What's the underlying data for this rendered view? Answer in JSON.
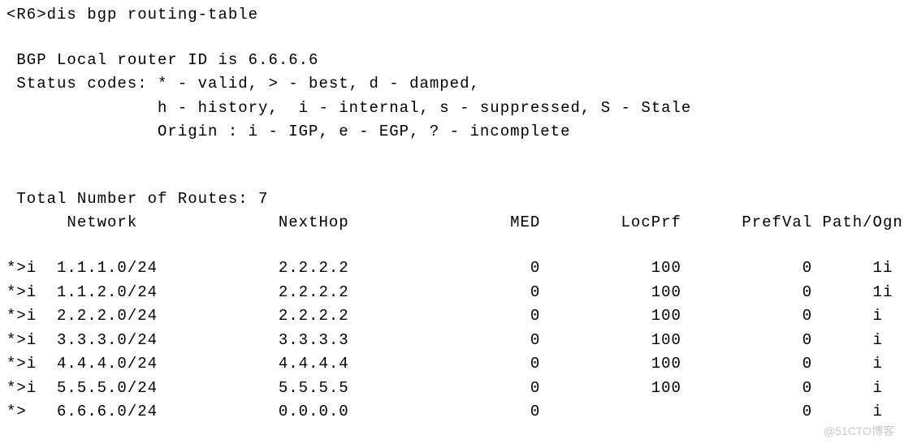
{
  "terminal": {
    "prompt": "<R6>",
    "command": "dis bgp routing-table",
    "router_id_line": " BGP Local router ID is 6.6.6.6",
    "status_line1": " Status codes: * - valid, > - best, d - damped,",
    "status_line2": "               h - history,  i - internal, s - suppressed, S - Stale",
    "status_line3": "               Origin : i - IGP, e - EGP, ? - incomplete",
    "total_routes": " Total Number of Routes: 7",
    "headers": {
      "network": "Network",
      "nexthop": "NextHop",
      "med": "MED",
      "locprf": "LocPrf",
      "prefval": "PrefVal",
      "pathogn": "Path/Ogn"
    },
    "routes": [
      {
        "status": "*>i",
        "network": "1.1.1.0/24",
        "nexthop": "2.2.2.2",
        "med": "0",
        "locprf": "100",
        "prefval": "0",
        "pathogn": "1i"
      },
      {
        "status": "*>i",
        "network": "1.1.2.0/24",
        "nexthop": "2.2.2.2",
        "med": "0",
        "locprf": "100",
        "prefval": "0",
        "pathogn": "1i"
      },
      {
        "status": "*>i",
        "network": "2.2.2.0/24",
        "nexthop": "2.2.2.2",
        "med": "0",
        "locprf": "100",
        "prefval": "0",
        "pathogn": "i"
      },
      {
        "status": "*>i",
        "network": "3.3.3.0/24",
        "nexthop": "3.3.3.3",
        "med": "0",
        "locprf": "100",
        "prefval": "0",
        "pathogn": "i"
      },
      {
        "status": "*>i",
        "network": "4.4.4.0/24",
        "nexthop": "4.4.4.4",
        "med": "0",
        "locprf": "100",
        "prefval": "0",
        "pathogn": "i"
      },
      {
        "status": "*>i",
        "network": "5.5.5.0/24",
        "nexthop": "5.5.5.5",
        "med": "0",
        "locprf": "100",
        "prefval": "0",
        "pathogn": "i"
      },
      {
        "status": "*>",
        "network": "6.6.6.0/24",
        "nexthop": "0.0.0.0",
        "med": "0",
        "locprf": "",
        "prefval": "0",
        "pathogn": "i"
      }
    ]
  },
  "watermark": "@51CTO博客"
}
